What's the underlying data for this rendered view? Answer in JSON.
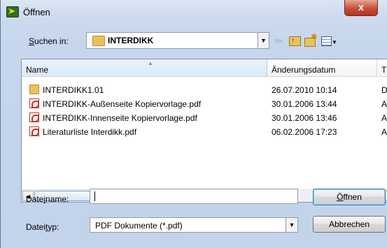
{
  "window": {
    "title": "Öffnen",
    "close_label": "x"
  },
  "toolbar": {
    "lookin_label": "Suchen in:",
    "lookin_value": "INTERDIKK",
    "icons": [
      "back-arrow-icon",
      "up-one-level-icon",
      "new-folder-icon",
      "views-menu-icon"
    ]
  },
  "columns": {
    "name": "Name",
    "date": "Änderungsdatum",
    "type": "T"
  },
  "files": [
    {
      "name": "INTERDIKK1.01",
      "date": "26.07.2010 10:14",
      "type": "D",
      "icon": "folder-icon"
    },
    {
      "name": "INTERDIKK-Außenseite Kopiervorlage.pdf",
      "date": "30.01.2006 13:44",
      "type": "A",
      "icon": "pdf-icon"
    },
    {
      "name": "INTERDIKK-Innenseite Kopiervorlage.pdf",
      "date": "30.01.2006 13:46",
      "type": "A",
      "icon": "pdf-icon"
    },
    {
      "name": "Literaturliste Interdikk.pdf",
      "date": "06.02.2006 17:23",
      "type": "A",
      "icon": "pdf-icon"
    }
  ],
  "scrollbar": {
    "thumb_grip": "III"
  },
  "filename": {
    "label": "Dateiname:",
    "value": ""
  },
  "filetype": {
    "label": "Dateityp:",
    "value": "PDF Dokumente (*.pdf)"
  },
  "buttons": {
    "open": "Öffnen",
    "cancel": "Abbrechen"
  },
  "colors": {
    "window_bg": "#c6d6ec",
    "close_button": "#c6503a",
    "pdf_red": "#c8301f",
    "folder_yellow": "#e9c15a"
  }
}
